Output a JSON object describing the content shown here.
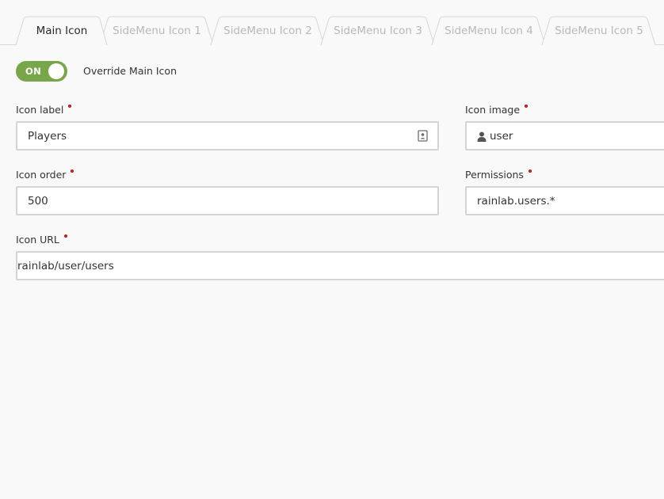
{
  "tabs": [
    {
      "label": "Main Icon",
      "active": true
    },
    {
      "label": "SideMenu Icon 1",
      "active": false
    },
    {
      "label": "SideMenu Icon 2",
      "active": false
    },
    {
      "label": "SideMenu Icon 3",
      "active": false
    },
    {
      "label": "SideMenu Icon 4",
      "active": false
    },
    {
      "label": "SideMenu Icon 5",
      "active": false
    }
  ],
  "override": {
    "toggle_state": "ON",
    "label": "Override Main Icon"
  },
  "fields": {
    "icon_label": {
      "label": "Icon label",
      "value": "Players",
      "icon": "contact-card-icon"
    },
    "icon_image": {
      "label": "Icon image",
      "value": "user",
      "icon": "user-icon"
    },
    "icon_order": {
      "label": "Icon order",
      "value": "500"
    },
    "permissions": {
      "label": "Permissions",
      "value": "rainlab.users.*"
    },
    "icon_url": {
      "label": "Icon URL",
      "value": "rainlab/user/users"
    }
  },
  "colors": {
    "toggle_on": "#7aa64a",
    "required_marker": "#c21d1d",
    "background": "#f9f9f9",
    "field_border": "#d4d4d4"
  }
}
